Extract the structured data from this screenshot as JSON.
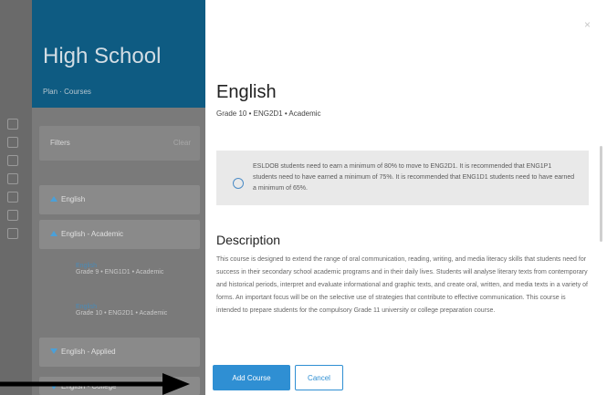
{
  "background": {
    "hero_title": "High School",
    "breadcrumb": "Plan  ·  Courses",
    "filters_label": "Filters",
    "filters_right": "Clear",
    "groups": [
      {
        "label": "English",
        "expanded": true
      },
      {
        "label": "English - Academic",
        "expanded": true
      },
      {
        "label": "English - Applied",
        "expanded": false
      },
      {
        "label": "English - College",
        "expanded": false
      }
    ],
    "course_items": [
      {
        "title": "English",
        "sub": "Grade 9 • ENG1D1 • Academic"
      },
      {
        "title": "English",
        "sub": "Grade 10 • ENG2D1 • Academic"
      }
    ],
    "rail_color": "#6a6a6a",
    "hero_color": "#0e5b82"
  },
  "modal": {
    "close_label": "×",
    "title": "English",
    "subtitle": "Grade 10  •  ENG2D1  •  Academic",
    "notice": "ESLDOB students need to earn a minimum of 80% to move to ENG2D1. It is recommended that ENG1P1 students need to have earned a minimum of 75%. It is recommended that ENG1D1 students need to have earned a minimum of 65%.",
    "description_heading": "Description",
    "description": "This course is designed to extend the range of oral communication, reading, writing, and media literacy skills that students need for success in their secondary school academic programs and in their daily lives. Students will analyse literary texts from contemporary and historical periods, interpret and evaluate informational and graphic texts, and create oral, written, and media texts in a variety of forms. An important focus will be on the selective use of strategies that contribute to effective communication. This course is intended to prepare students for the compulsory Grade 11 university or college preparation course.",
    "add_button": "Add Course",
    "cancel_button": "Cancel",
    "accent": "#2f8fd3"
  }
}
